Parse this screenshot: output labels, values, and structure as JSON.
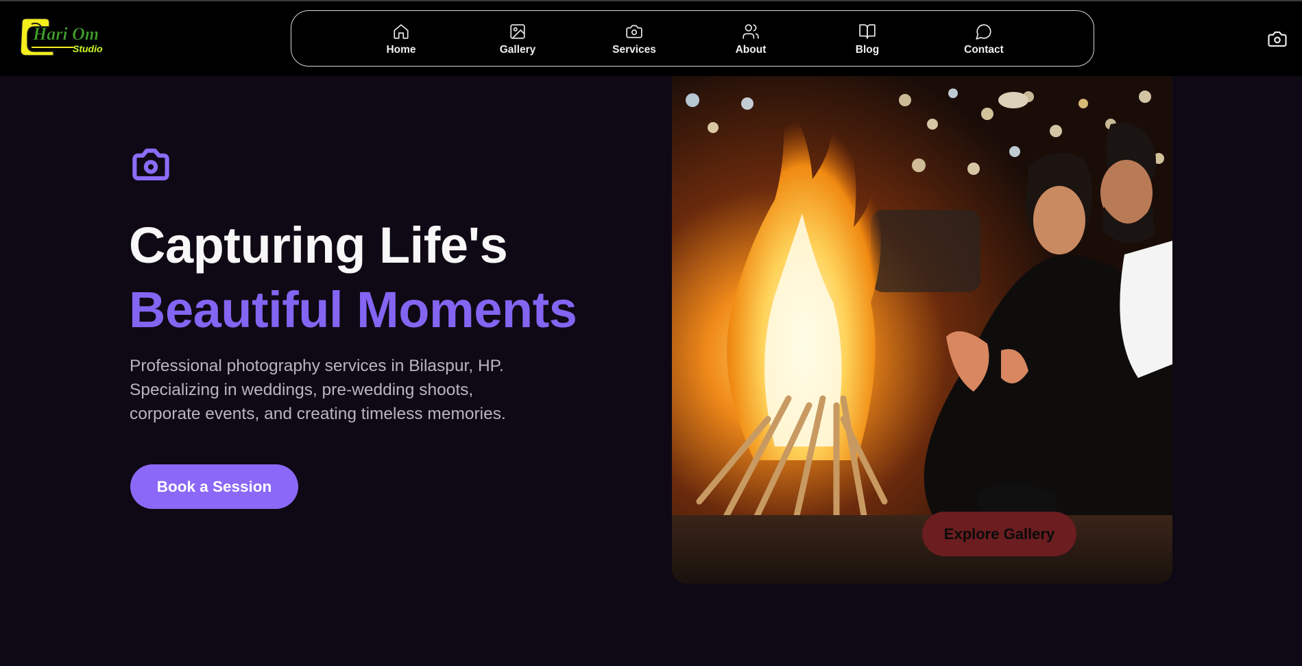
{
  "brand": {
    "logo_line1": "Hari Om",
    "logo_line2": "Studio",
    "colors": {
      "logo_yellow": "#f5ef1e",
      "logo_green": "#3fa12a"
    }
  },
  "nav": {
    "items": [
      {
        "label": "Home",
        "icon": "home-icon"
      },
      {
        "label": "Gallery",
        "icon": "image-icon"
      },
      {
        "label": "Services",
        "icon": "camera-icon"
      },
      {
        "label": "About",
        "icon": "users-icon"
      },
      {
        "label": "Blog",
        "icon": "book-open-icon"
      },
      {
        "label": "Contact",
        "icon": "message-circle-icon"
      }
    ]
  },
  "header_action": {
    "icon": "camera-icon"
  },
  "hero": {
    "icon": "camera-icon",
    "title_line1": "Capturing Life's",
    "title_line2": "Beautiful Moments",
    "description": "Professional photography services in Bilaspur, HP. Specializing in weddings, pre-wedding shoots, corporate events, and creating timeless memories.",
    "cta_primary": "Book a Session",
    "cta_secondary": "Explore Gallery",
    "colors": {
      "accent": "#8465f2",
      "button": "#8b68f7",
      "background": "#0e0914",
      "gallery_button": "#6b1d1f"
    }
  }
}
